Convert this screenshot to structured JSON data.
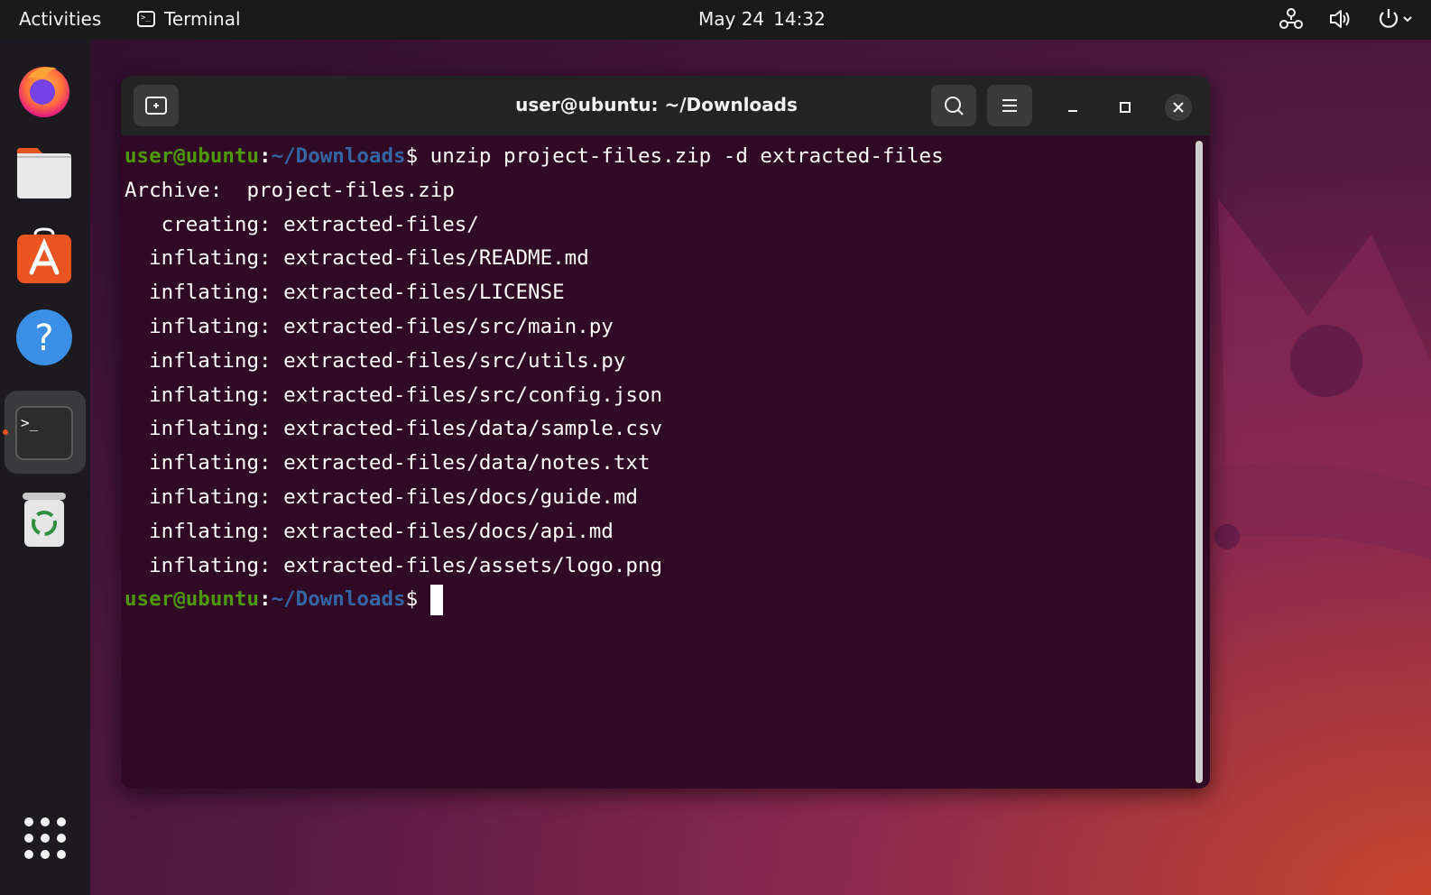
{
  "topbar": {
    "activities": "Activities",
    "app_name": "Terminal",
    "date": "May 24",
    "time": "14:32",
    "term_icon_glyph": ">_"
  },
  "dock": {
    "items": [
      {
        "name": "Firefox",
        "icon": "firefox-icon"
      },
      {
        "name": "Files",
        "icon": "files-icon"
      },
      {
        "name": "Ubuntu Software",
        "icon": "software-icon",
        "glyph": "A"
      },
      {
        "name": "Help",
        "icon": "help-icon",
        "glyph": "?"
      },
      {
        "name": "Terminal",
        "icon": "terminal-icon",
        "glyph": ">_",
        "active": true
      },
      {
        "name": "Trash",
        "icon": "trash-icon",
        "glyph": "♻"
      }
    ],
    "show_apps": "apps-grid-icon"
  },
  "window": {
    "title": "user@ubuntu: ~/Downloads"
  },
  "terminal": {
    "prompt": {
      "user": "user@ubuntu",
      "colon": ":",
      "path": "~/Downloads",
      "dollar": "$"
    },
    "command": " unzip project-files.zip -d extracted-files",
    "output": [
      "Archive:  project-files.zip",
      "   creating: extracted-files/",
      "  inflating: extracted-files/README.md",
      "  inflating: extracted-files/LICENSE",
      "  inflating: extracted-files/src/main.py",
      "  inflating: extracted-files/src/utils.py",
      "  inflating: extracted-files/src/config.json",
      "  inflating: extracted-files/data/sample.csv",
      "  inflating: extracted-files/data/notes.txt",
      "  inflating: extracted-files/docs/guide.md",
      "  inflating: extracted-files/docs/api.md",
      "  inflating: extracted-files/assets/logo.png"
    ]
  },
  "colors": {
    "terminal_bg": "#300a24",
    "prompt_user": "#4e9a06",
    "prompt_path": "#3465a4",
    "accent": "#e95420"
  }
}
